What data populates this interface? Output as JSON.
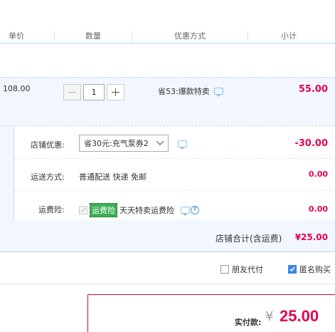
{
  "header": {
    "col_price": "单价",
    "col_qty": "数量",
    "col_promo": "优惠方式",
    "col_subtotal": "小计"
  },
  "item": {
    "price": "108.00",
    "quantity": "1",
    "promo_text": "省53:爆款特卖",
    "subtotal": "55.00"
  },
  "shop": {
    "discount_label": "店铺优惠:",
    "discount_selected": "省30元:充气泵券2",
    "discount_value": "-30.00",
    "shipping_label": "运送方式:",
    "shipping_value": "普通配送 快递 免邮",
    "shipping_cost": "0.00",
    "insurance_label": "运费险:",
    "insurance_tag": "运费险",
    "insurance_text": "天天特卖运费险",
    "insurance_cost": "0.00",
    "total_label": "店铺合计(含运费)",
    "total_value": "¥25.00"
  },
  "options": {
    "friend_pay": "朋友代付",
    "anonymous": "匿名购买",
    "anonymous_checked": true
  },
  "payment": {
    "label": "实付款:",
    "currency": "¥",
    "amount": "25.00"
  },
  "colors": {
    "accent_red": "#e4004f",
    "border_blue": "#b4d0f0",
    "tag_green": "#3bae54"
  }
}
